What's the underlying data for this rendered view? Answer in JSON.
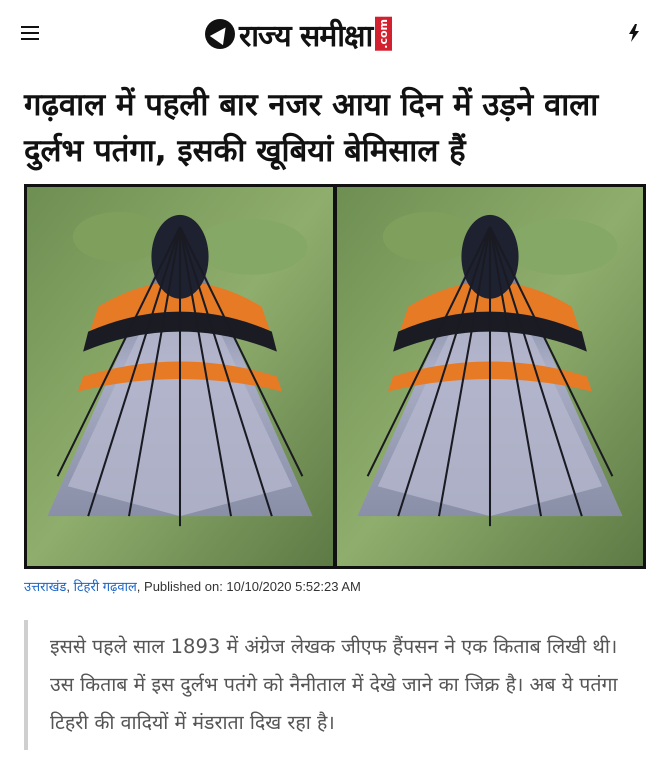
{
  "header": {
    "logo_text": "राज्य समीक्षा",
    "logo_suffix": ".com",
    "menu_icon": "hamburger-menu-icon",
    "flash_icon": "lightning-bolt-icon"
  },
  "article": {
    "title": "गढ़वाल में पहली बार नजर आया दिन में उड़ने वाला दुर्लभ पतंगा, इसकी खूबियां बेमिसाल हैं",
    "categories": [
      "उत्तराखंड",
      "टिहरी गढ़वाल"
    ],
    "category_sep": ", ",
    "published": ", Published on: 10/10/2020 5:52:23 AM",
    "quote": "इससे पहले साल 1893 में अंग्रेज लेखक जीएफ हैंपसन ने एक किताब लिखी थी। उस किताब में इस दुर्लभ पतंगे को नैनीताल में देखे जाने का जिक्र है। अब ये पतंगा टिहरी की वादियों में मंडराता दिख रहा है।"
  },
  "colors": {
    "link": "#1a63c8",
    "brand_red": "#d3202f",
    "quote_text": "#555555",
    "quote_border": "#cfcfcf"
  }
}
